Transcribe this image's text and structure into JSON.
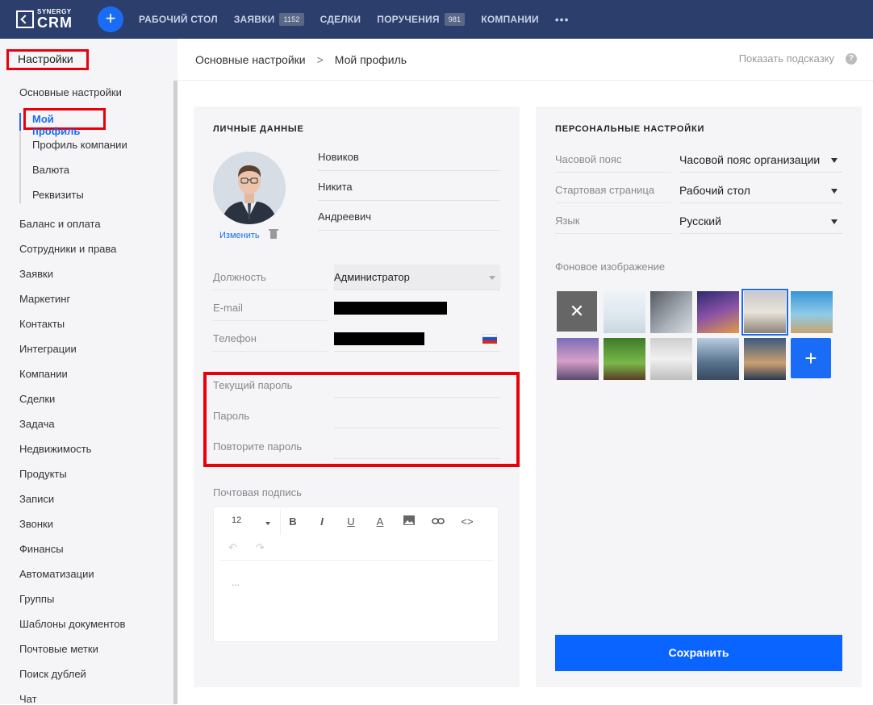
{
  "topbar": {
    "logo_small": "SYNERGY",
    "logo_big": "CRM",
    "add_label": "+",
    "nav": [
      {
        "label": "РАБОЧИЙ СТОЛ",
        "badge": ""
      },
      {
        "label": "ЗАЯВКИ",
        "badge": "1152"
      },
      {
        "label": "СДЕЛКИ",
        "badge": ""
      },
      {
        "label": "ПОРУЧЕНИЯ",
        "badge": "981"
      },
      {
        "label": "КОМПАНИИ",
        "badge": ""
      }
    ],
    "more": "•••"
  },
  "sidebar": {
    "title": "Настройки",
    "section": "Основные настройки",
    "sub_items": [
      "Мой профиль",
      "Профиль компании",
      "Валюта",
      "Реквизиты"
    ],
    "items": [
      "Баланс и оплата",
      "Сотрудники и права",
      "Заявки",
      "Маркетинг",
      "Контакты",
      "Интеграции",
      "Компании",
      "Сделки",
      "Задача",
      "Недвижимость",
      "Продукты",
      "Записи",
      "Звонки",
      "Финансы",
      "Автоматизации",
      "Группы",
      "Шаблоны документов",
      "Почтовые метки",
      "Поиск дублей",
      "Чат"
    ]
  },
  "header": {
    "breadcrumb_root": "Основные настройки",
    "breadcrumb_sep": ">",
    "breadcrumb_current": "Мой профиль",
    "hint": "Показать подсказку",
    "hint_icon": "?"
  },
  "personal": {
    "title": "ЛИЧНЫЕ ДАННЫЕ",
    "change": "Изменить",
    "last_name": "Новиков",
    "first_name": "Никита",
    "middle_name": "Андреевич",
    "position_label": "Должность",
    "position_value": "Администратор",
    "email_label": "E-mail",
    "phone_label": "Телефон",
    "current_password_label": "Текущий пароль",
    "password_label": "Пароль",
    "repeat_password_label": "Повторите пароль",
    "signature_label": "Почтовая подпись",
    "font_size": "12",
    "editor_text": "..."
  },
  "settings": {
    "title": "ПЕРСОНАЛЬНЫЕ НАСТРОЙКИ",
    "timezone_label": "Часовой пояс",
    "timezone_value": "Часовой пояс организации",
    "start_label": "Стартовая страница",
    "start_value": "Рабочий стол",
    "lang_label": "Язык",
    "lang_value": "Русский",
    "bg_label": "Фоновое изображение",
    "bg_none": "✕",
    "bg_add": "+",
    "save": "Сохранить"
  },
  "colors": {
    "topbar": "#2c3e6b",
    "accent": "#1a6cf6",
    "highlight": "#e8000b"
  }
}
